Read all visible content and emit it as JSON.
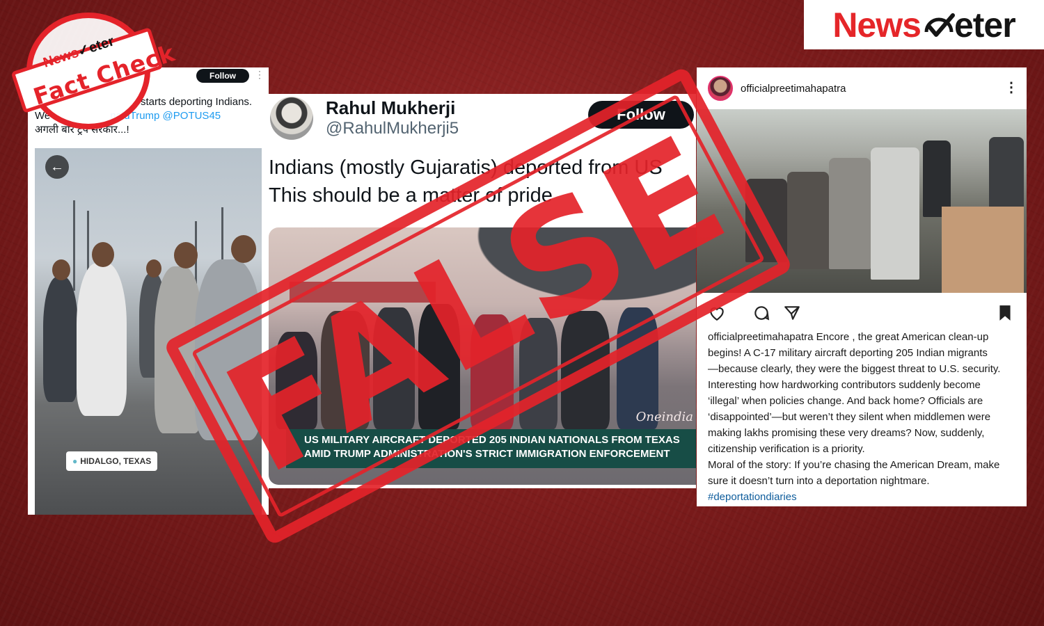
{
  "brand": {
    "logo_news": "News",
    "logo_meter": "eter",
    "accent": "#e52629"
  },
  "fact_check": {
    "brand_news": "News",
    "brand_meter": "eter",
    "title": "Fact Check"
  },
  "stamp": {
    "label": "FALSE",
    "color": "#e4232a"
  },
  "left_tweet": {
    "follow_label": "Follow",
    "line1": "starts deporting Indians.",
    "line2_prefix": "We",
    "line2_link": "naldTrump @POTUS45",
    "line3": "अगली बार ट्रंप सरकार...!",
    "location_label": "HIDALGO, TEXAS",
    "back_icon": "back-arrow-icon"
  },
  "mid_tweet": {
    "author_name": "Rahul Mukherji",
    "author_handle": "@RahulMukherji5",
    "follow_label": "Follow",
    "text_line1": "Indians (mostly Gujaratis) deported from US",
    "text_line2": "This should be a matter of pride",
    "banner_line1": "US MILITARY AIRCRAFT DEPORTED 205 INDIAN NATIONALS FROM TEXAS",
    "banner_line2": "AMID TRUMP ADMINISTRATION'S STRICT IMMIGRATION ENFORCEMENT",
    "watermark": "Oneindia"
  },
  "ig_post": {
    "username": "officialpreetimahapatra",
    "caption_user": "officialpreetimahapatra",
    "caption_lines": [
      "Encore , the great American clean-up",
      "begins! A C-17 military aircraft deporting 205 Indian migrants",
      "—because clearly, they were the biggest threat to U.S. security.",
      "Interesting how hardworking contributors suddenly become",
      "‘illegal’ when policies change. And back home? Officials are",
      "‘disappointed’—but weren’t they silent when middlemen were",
      "making lakhs promising these very dreams? Now, suddenly,",
      "citizenship verification is a priority.",
      "Moral of the story: If you’re chasing the American Dream, make",
      "sure it doesn’t turn into a deportation nightmare."
    ],
    "hashtag": "#deportationdiaries",
    "icons": [
      "heart-icon",
      "comment-icon",
      "share-icon",
      "bookmark-icon"
    ]
  }
}
